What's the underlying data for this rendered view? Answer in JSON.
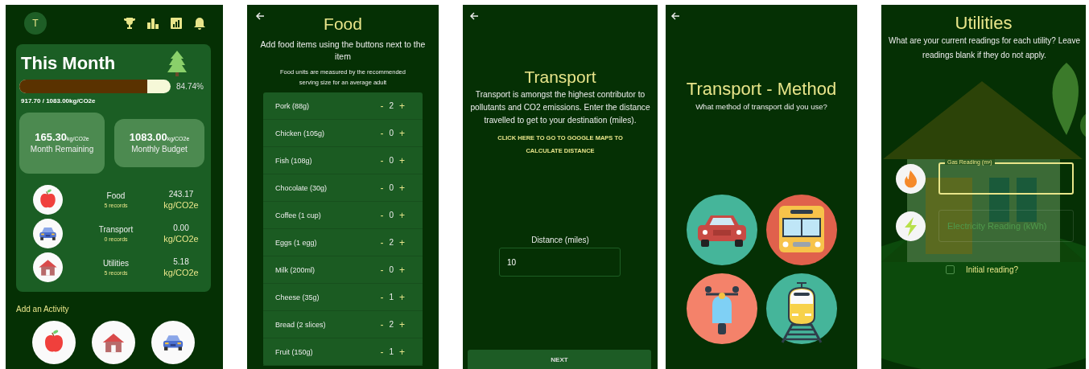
{
  "home": {
    "avatar": "T",
    "card": {
      "title": "This Month",
      "progress": {
        "level": 0.8474
      },
      "percent": "84.74%",
      "total": "917.70 / 1083.00kg/CO2e",
      "stats": [
        {
          "value": "165.30",
          "unit": "kg/CO2e",
          "label": "Month Remaining"
        },
        {
          "value": "1083.00",
          "unit": "kg/CO2e",
          "label": "Monthly Budget"
        }
      ],
      "categories": [
        {
          "kind": "food",
          "name": "Food",
          "records": "5 records",
          "value": "243.17",
          "unit": "kg/CO2e"
        },
        {
          "kind": "transport",
          "name": "Transport",
          "records": "0 records",
          "value": "0.00",
          "unit": "kg/CO2e"
        },
        {
          "kind": "utilities",
          "name": "Utilities",
          "records": "5 records",
          "value": "5.18",
          "unit": "kg/CO2e"
        }
      ]
    },
    "add_label": "Add an Activity",
    "activities": [
      {
        "kind": "food"
      },
      {
        "kind": "utilities"
      },
      {
        "kind": "transport"
      }
    ]
  },
  "food": {
    "title": "Food",
    "intro": "Add food items using the buttons next to the item",
    "note": "Food units are measured by the recommended serving size for an average adult",
    "minus": "-",
    "plus": "+",
    "items": [
      {
        "name": "Pork (88g)",
        "count": "2"
      },
      {
        "name": "Chicken (105g)",
        "count": "0"
      },
      {
        "name": "Fish (108g)",
        "count": "0"
      },
      {
        "name": "Chocolate (30g)",
        "count": "0"
      },
      {
        "name": "Coffee (1 cup)",
        "count": "0"
      },
      {
        "name": "Eggs (1 egg)",
        "count": "2"
      },
      {
        "name": "Milk (200ml)",
        "count": "0"
      },
      {
        "name": "Cheese (35g)",
        "count": "1"
      },
      {
        "name": "Bread (2 slices)",
        "count": "2"
      },
      {
        "name": "Fruit (150g)",
        "count": "1"
      }
    ]
  },
  "transport": {
    "title": "Transport",
    "description": "Transport is amongst the highest contributor to pollutants and CO2 emissions. Enter the distance travelled to get to your destination (miles).",
    "link": "CLICK HERE TO GO TO GOOGLE MAPS TO CALCULATE DISTANCE",
    "distance_label": "Distance (miles)",
    "distance_value": "10",
    "next_button": "NEXT"
  },
  "transport_method": {
    "title": "Transport - Method",
    "subtitle": "What method of transport did you use?",
    "options": [
      {
        "kind": "car"
      },
      {
        "kind": "bus"
      },
      {
        "kind": "scooter"
      },
      {
        "kind": "train"
      }
    ]
  },
  "utilities": {
    "title": "Utilities",
    "description": "What are your current readings for each utility? Leave readings blank if they do not apply.",
    "fields": [
      {
        "kind": "gas",
        "label": "Gas Reading (m³)",
        "focused": true
      },
      {
        "kind": "electricity",
        "placeholder": "Electricity Reading (kWh)",
        "focused": false
      }
    ],
    "initial_reading": {
      "label": "Initial reading?",
      "checked": false
    }
  }
}
